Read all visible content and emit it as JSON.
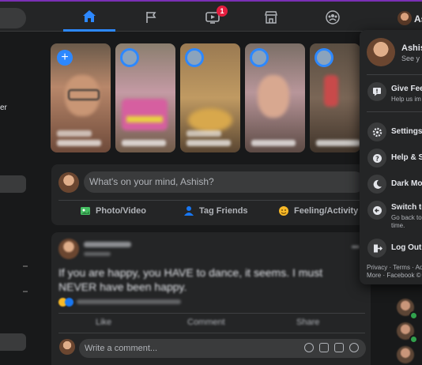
{
  "topbar": {
    "home_icon": "home-icon",
    "pages_icon": "flag-icon",
    "watch_icon": "video-icon",
    "watch_badge": "1",
    "marketplace_icon": "store-icon",
    "groups_icon": "groups-icon",
    "profile_name": "As"
  },
  "left": {
    "partial_text": "er"
  },
  "composer": {
    "placeholder": "What's on your mind, Ashish?",
    "actions": [
      {
        "label": "Photo/Video",
        "icon": "photo-icon",
        "color": "#45bd62"
      },
      {
        "label": "Tag Friends",
        "icon": "tag-friends-icon",
        "color": "#1877f2"
      },
      {
        "label": "Feeling/Activity",
        "icon": "feeling-icon",
        "color": "#f7b928"
      }
    ]
  },
  "post": {
    "text_line1": "If you are happy, you HAVE to dance, it seems. I must",
    "text_line2": "NEVER have been happy.",
    "actions": [
      "Like",
      "Comment",
      "Share"
    ],
    "comment_placeholder": "Write a comment..."
  },
  "menu": {
    "profile_name": "Ashis",
    "profile_sub": "See y",
    "items": [
      {
        "label": "Give Fee",
        "sub": "Help us im",
        "icon": "feedback-icon"
      },
      {
        "label": "Settings",
        "icon": "gear-icon"
      },
      {
        "label": "Help & S",
        "icon": "help-icon"
      },
      {
        "label": "Dark Mo",
        "icon": "moon-icon"
      },
      {
        "label": "Switch to",
        "sub1": "Go back to",
        "sub2": "time.",
        "icon": "switch-icon"
      },
      {
        "label": "Log Out",
        "icon": "logout-icon"
      }
    ],
    "footer_line1": "Privacy · Terms · Ad",
    "footer_line2": "More · Facebook ©"
  },
  "colors": {
    "accent": "#2d88ff",
    "bg": "#18191a",
    "surface": "#242526",
    "badge": "#e41e3f"
  }
}
